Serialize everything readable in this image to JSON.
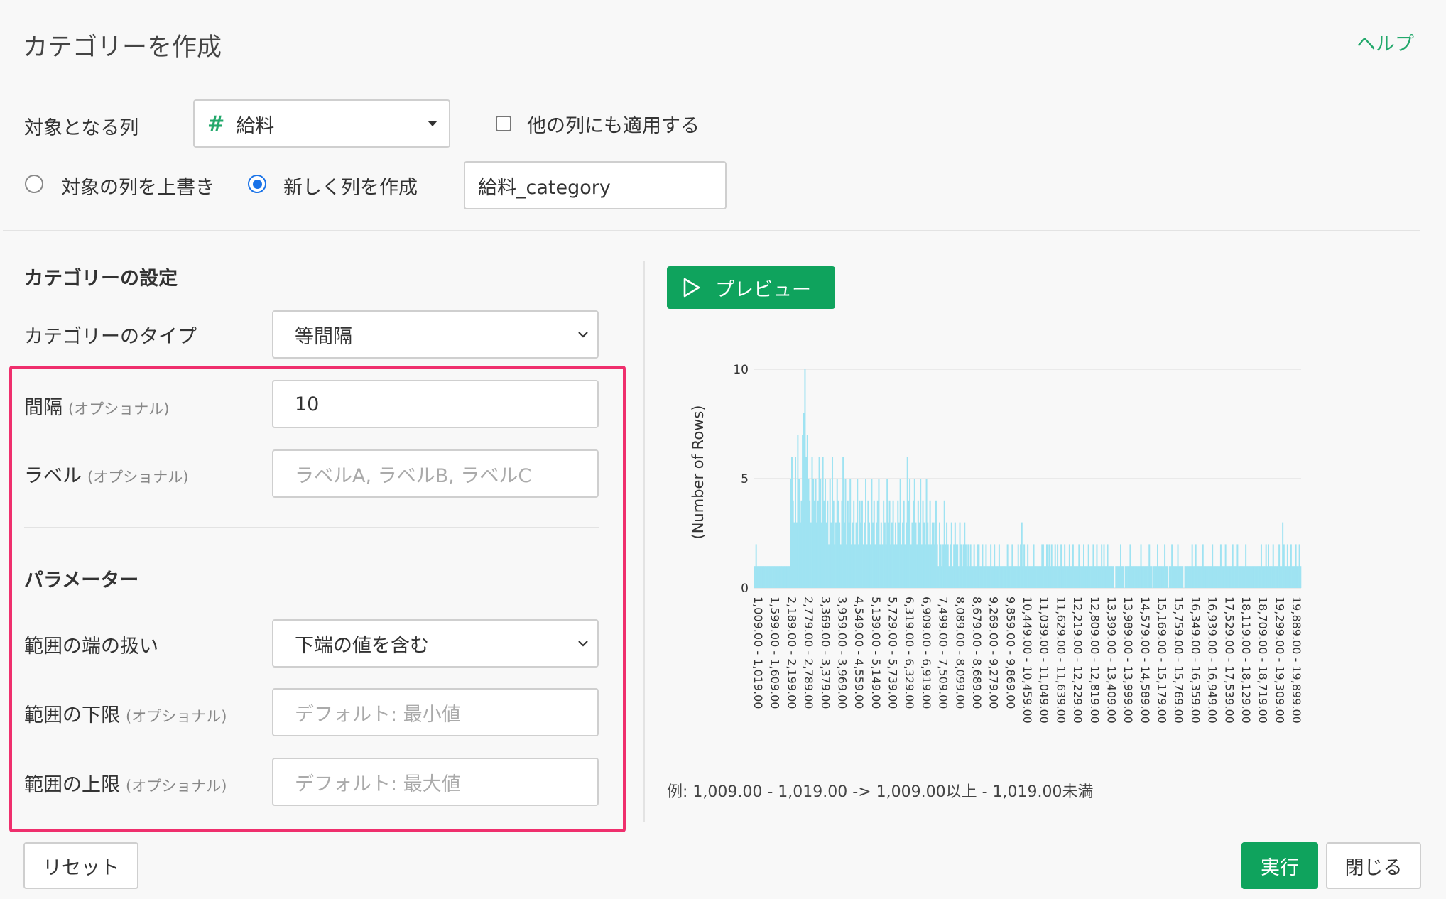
{
  "header": {
    "title": "カテゴリーを作成",
    "help_label": "ヘルプ"
  },
  "target": {
    "label": "対象となる列",
    "column_type_icon": "#",
    "column_value": "給料",
    "apply_other_label": "他の列にも適用する",
    "apply_other_checked": false
  },
  "output": {
    "overwrite_label": "対象の列を上書き",
    "new_column_label": "新しく列を作成",
    "selected": "new_column",
    "new_column_name": "給料_category"
  },
  "settings": {
    "section_title": "カテゴリーの設定",
    "type_label": "カテゴリーのタイプ",
    "type_value": "等間隔",
    "interval_label": "間隔",
    "interval_optional": "(オプショナル)",
    "interval_value": "10",
    "labels_label": "ラベル",
    "labels_optional": "(オプショナル)",
    "labels_placeholder": "ラベルA, ラベルB, ラベルC",
    "params_title": "パラメーター",
    "edge_label": "範囲の端の扱い",
    "edge_value": "下端の値を含む",
    "lower_label": "範囲の下限",
    "lower_optional": "(オプショナル)",
    "lower_placeholder": "デフォルト: 最小値",
    "upper_label": "範囲の上限",
    "upper_optional": "(オプショナル)",
    "upper_placeholder": "デフォルト: 最大値"
  },
  "preview": {
    "button_label": "プレビュー",
    "example_text": "例: 1,009.00 - 1,019.00 -> 1,009.00以上 - 1,019.00未満"
  },
  "footer": {
    "reset_label": "リセット",
    "run_label": "実行",
    "close_label": "閉じる"
  },
  "colors": {
    "accent_green": "#0fa35d",
    "help_green": "#22a86b",
    "highlight": "#ef2f6d",
    "bar": "#9fe3f2",
    "radio_blue": "#1a73e8"
  },
  "chart_data": {
    "type": "bar",
    "ylabel": "(Number of Rows)",
    "xlabel": "",
    "ylim": [
      0,
      10
    ],
    "yticks": [
      0,
      5,
      10
    ],
    "grid": true,
    "legend": "none",
    "tick_labels": [
      "1,009.00 - 1,019.00",
      "1,599.00 - 1,609.00",
      "2,189.00 - 2,199.00",
      "2,779.00 - 2,789.00",
      "3,369.00 - 3,379.00",
      "3,959.00 - 3,969.00",
      "4,549.00 - 4,559.00",
      "5,139.00 - 5,149.00",
      "5,729.00 - 5,739.00",
      "6,319.00 - 6,329.00",
      "6,909.00 - 6,919.00",
      "7,499.00 - 7,509.00",
      "8,089.00 - 8,099.00",
      "8,679.00 - 8,689.00",
      "9,269.00 - 9,279.00",
      "9,859.00 - 9,869.00",
      "10,449.00 - 10,459.00",
      "11,039.00 - 11,049.00",
      "11,629.00 - 11,639.00",
      "12,219.00 - 12,229.00",
      "12,809.00 - 12,819.00",
      "13,399.00 - 13,409.00",
      "13,989.00 - 13,999.00",
      "14,579.00 - 14,589.00",
      "15,169.00 - 15,179.00",
      "15,759.00 - 15,769.00",
      "16,349.00 - 16,359.00",
      "16,939.00 - 16,949.00",
      "17,529.00 - 17,539.00",
      "18,119.00 - 18,129.00",
      "18,709.00 - 18,719.00",
      "19,299.00 - 19,309.00",
      "19,889.00 - 19,899.00"
    ],
    "values": [
      1,
      2,
      1,
      1,
      1,
      1,
      1,
      1,
      1,
      1,
      1,
      1,
      1,
      1,
      1,
      1,
      1,
      1,
      1,
      1,
      1,
      1,
      1,
      1,
      1,
      1,
      1,
      1,
      1,
      1,
      5,
      6,
      4,
      3,
      6,
      3,
      7,
      5,
      3,
      4,
      7,
      8,
      10,
      6,
      7,
      5,
      4,
      3,
      6,
      5,
      4,
      5,
      3,
      4,
      6,
      5,
      3,
      6,
      4,
      5,
      3,
      4,
      2,
      5,
      3,
      6,
      4,
      2,
      3,
      5,
      4,
      3,
      2,
      4,
      6,
      3,
      5,
      2,
      4,
      3,
      5,
      2,
      3,
      4,
      2,
      3,
      5,
      2,
      4,
      3,
      4,
      2,
      3,
      5,
      2,
      4,
      3,
      2,
      5,
      3,
      4,
      2,
      3,
      4,
      5,
      2,
      3,
      2,
      4,
      3,
      2,
      5,
      3,
      4,
      2,
      3,
      4,
      2,
      3,
      2,
      4,
      3,
      5,
      2,
      3,
      4,
      2,
      3,
      6,
      4,
      5,
      2,
      3,
      4,
      5,
      3,
      2,
      4,
      3,
      5,
      2,
      4,
      3,
      2,
      5,
      3,
      2,
      4,
      2,
      3,
      3,
      2,
      4,
      2,
      1,
      3,
      2,
      1,
      2,
      4,
      2,
      3,
      2,
      1,
      2,
      3,
      1,
      2,
      3,
      2,
      2,
      1,
      3,
      2,
      1,
      2,
      3,
      2,
      1,
      2,
      1,
      2,
      1,
      1,
      2,
      1,
      1,
      2,
      2,
      1,
      1,
      2,
      1,
      1,
      2,
      1,
      1,
      1,
      2,
      1,
      1,
      2,
      1,
      1,
      1,
      2,
      1,
      1,
      1,
      1,
      1,
      1,
      2,
      1,
      1,
      1,
      2,
      1,
      1,
      1,
      1,
      2,
      1,
      2,
      3,
      1,
      2,
      1,
      1,
      2,
      1,
      1,
      1,
      1,
      2,
      1,
      1,
      1,
      1,
      1,
      1,
      2,
      2,
      1,
      1,
      2,
      1,
      2,
      1,
      2,
      1,
      1,
      2,
      1,
      2,
      1,
      1,
      2,
      1,
      1,
      2,
      1,
      1,
      1,
      2,
      1,
      1,
      2,
      1,
      1,
      1,
      1,
      2,
      1,
      1,
      1,
      2,
      1,
      1,
      1,
      2,
      1,
      1,
      1,
      2,
      1,
      1,
      2,
      1,
      1,
      1,
      2,
      1,
      2,
      1,
      1,
      2,
      1,
      1,
      1,
      1,
      1,
      0,
      1,
      1,
      1,
      1,
      2,
      1,
      1,
      0,
      1,
      1,
      1,
      1,
      2,
      1,
      1,
      1,
      1,
      1,
      1,
      1,
      1,
      2,
      1,
      1,
      1,
      1,
      1,
      1,
      2,
      1,
      1,
      0,
      1,
      1,
      1,
      2,
      1,
      1,
      1,
      1,
      1,
      2,
      1,
      1,
      0,
      1,
      1,
      2,
      1,
      1,
      1,
      1,
      2,
      1,
      1,
      1,
      1,
      0,
      1,
      1,
      1,
      1,
      1,
      1,
      2,
      1,
      1,
      2,
      1,
      1,
      1,
      1,
      1,
      2,
      1,
      1,
      1,
      1,
      1,
      1,
      1,
      2,
      1,
      1,
      1,
      1,
      1,
      1,
      2,
      1,
      1,
      1,
      2,
      1,
      1,
      1,
      1,
      1,
      2,
      1,
      1,
      1,
      2,
      1,
      1,
      1,
      1,
      1,
      1,
      2,
      1,
      1,
      1,
      1,
      1,
      1,
      1,
      1,
      1,
      1,
      1,
      1,
      2,
      1,
      1,
      1,
      2,
      1,
      2,
      1,
      1,
      1,
      2,
      1,
      1,
      1,
      1,
      2,
      1,
      1,
      3,
      2,
      1,
      1,
      2,
      1,
      1,
      2,
      1,
      1,
      1,
      2,
      1,
      1,
      2,
      1
    ]
  }
}
